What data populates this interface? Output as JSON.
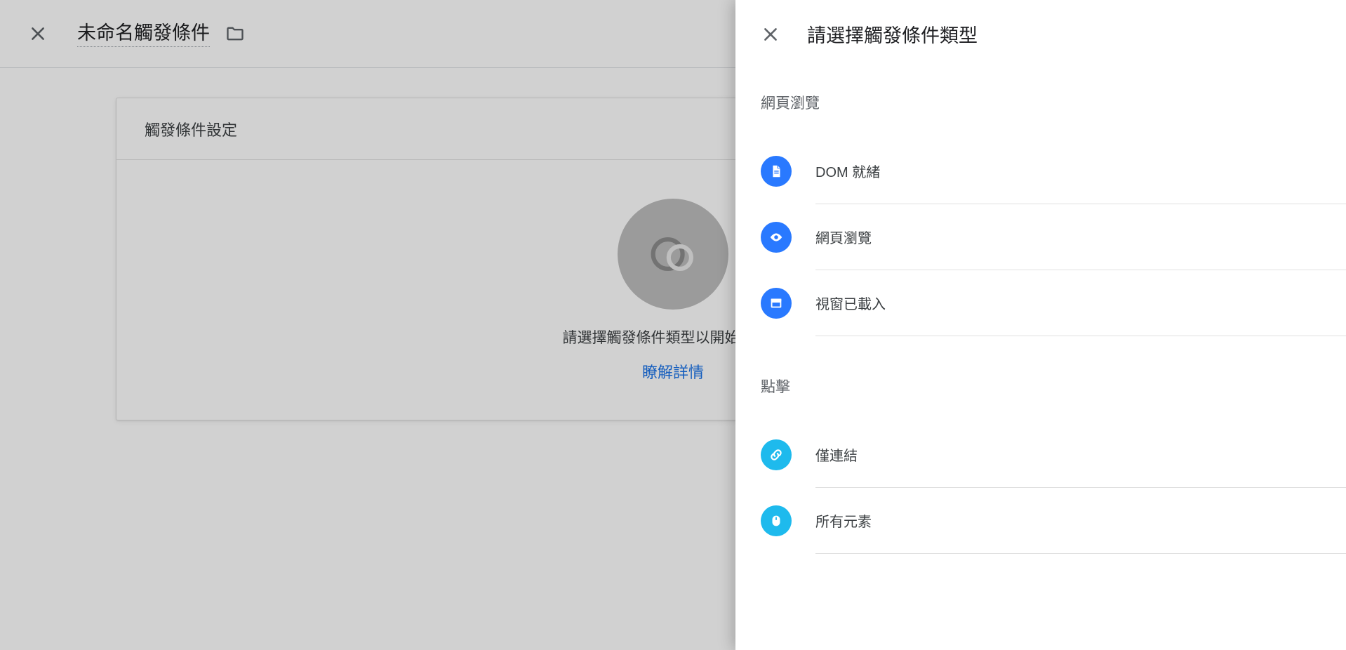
{
  "header": {
    "title": "未命名觸發條件"
  },
  "card": {
    "heading": "觸發條件設定",
    "prompt": "請選擇觸發條件類型以開始設定…",
    "learn_more": "瞭解詳情"
  },
  "panel": {
    "title": "請選擇觸發條件類型",
    "groups": [
      {
        "label": "網頁瀏覽",
        "items": [
          {
            "label": "DOM 就緒",
            "icon": "document",
            "color": "blue"
          },
          {
            "label": "網頁瀏覽",
            "icon": "eye",
            "color": "blue"
          },
          {
            "label": "視窗已載入",
            "icon": "window",
            "color": "blue"
          }
        ]
      },
      {
        "label": "點擊",
        "items": [
          {
            "label": "僅連結",
            "icon": "link",
            "color": "cyan"
          },
          {
            "label": "所有元素",
            "icon": "mouse",
            "color": "cyan"
          }
        ]
      }
    ]
  }
}
